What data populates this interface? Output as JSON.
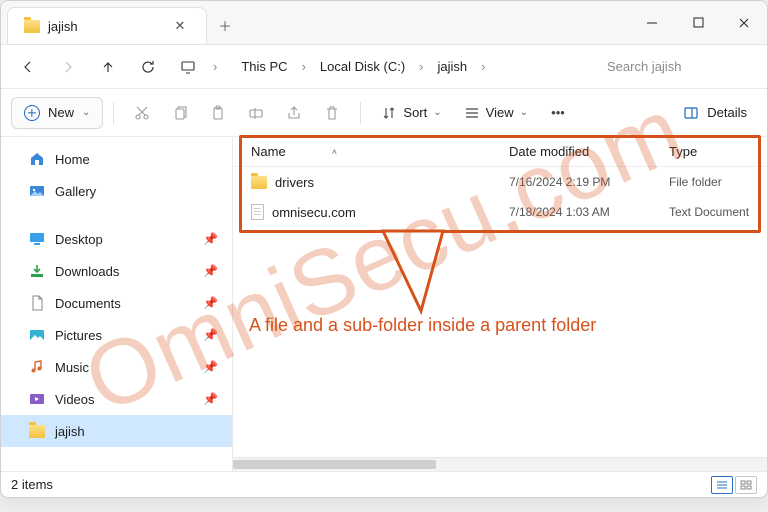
{
  "tab": {
    "title": "jajish"
  },
  "breadcrumbs": [
    "This PC",
    "Local Disk (C:)",
    "jajish"
  ],
  "search": {
    "placeholder": "Search jajish"
  },
  "toolbar": {
    "new_label": "New",
    "sort_label": "Sort",
    "view_label": "View",
    "details_label": "Details"
  },
  "sidebar": {
    "top": [
      {
        "label": "Home",
        "icon": "home"
      },
      {
        "label": "Gallery",
        "icon": "gallery"
      }
    ],
    "pinned": [
      {
        "label": "Desktop",
        "icon": "desktop"
      },
      {
        "label": "Downloads",
        "icon": "downloads"
      },
      {
        "label": "Documents",
        "icon": "documents"
      },
      {
        "label": "Pictures",
        "icon": "pictures"
      },
      {
        "label": "Music",
        "icon": "music"
      },
      {
        "label": "Videos",
        "icon": "videos"
      },
      {
        "label": "jajish",
        "icon": "folder",
        "selected": true
      }
    ]
  },
  "columns": {
    "name": "Name",
    "date": "Date modified",
    "type": "Type"
  },
  "files": [
    {
      "name": "drivers",
      "date": "7/16/2024 2:19 PM",
      "type": "File folder",
      "icon": "folder"
    },
    {
      "name": "omnisecu.com",
      "date": "7/18/2024 1:03 AM",
      "type": "Text Document",
      "icon": "text"
    }
  ],
  "status": {
    "count_label": "2 items"
  },
  "annotation": {
    "text": "A file and a sub-folder inside a parent folder",
    "watermark": "OmniSecu.com"
  }
}
